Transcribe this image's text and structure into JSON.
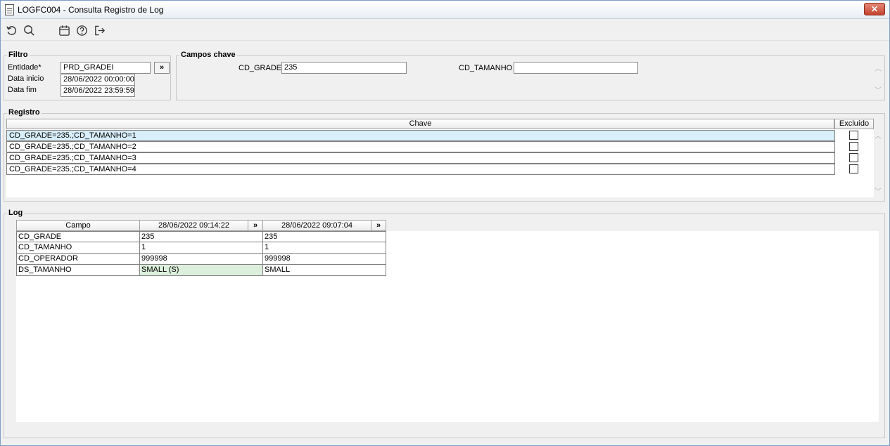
{
  "window": {
    "title": "LOGFC004 - Consulta Registro de Log",
    "close_label": "✕"
  },
  "toolbar": {
    "buttons": [
      {
        "name": "refresh-icon"
      },
      {
        "name": "search-icon"
      },
      {
        "name": "calendar-icon"
      },
      {
        "name": "help-icon"
      },
      {
        "name": "exit-icon"
      }
    ]
  },
  "filtro": {
    "legend": "Filtro",
    "entidade_label": "Entidade*",
    "entidade_value": "PRD_GRADEI",
    "entidade_button": "»",
    "data_inicio_label": "Data inicio",
    "data_inicio_value": "28/06/2022 00:00:00",
    "data_fim_label": "Data fim",
    "data_fim_value": "28/06/2022 23:59:59"
  },
  "campos_chave": {
    "legend": "Campos chave",
    "fields": [
      {
        "label": "CD_GRADE",
        "value": "235"
      },
      {
        "label": "CD_TAMANHO",
        "value": ""
      }
    ]
  },
  "registro": {
    "legend": "Registro",
    "col_chave": "Chave",
    "col_excluido": "Excluído",
    "rows": [
      {
        "chave": "CD_GRADE=235.;CD_TAMANHO=1",
        "excluido": false
      },
      {
        "chave": "CD_GRADE=235.;CD_TAMANHO=2",
        "excluido": false
      },
      {
        "chave": "CD_GRADE=235.;CD_TAMANHO=3",
        "excluido": false
      },
      {
        "chave": "CD_GRADE=235.;CD_TAMANHO=4",
        "excluido": false
      }
    ]
  },
  "log": {
    "legend": "Log",
    "col_campo": "Campo",
    "columns": [
      {
        "timestamp": "28/06/2022 09:14:22",
        "button": "»"
      },
      {
        "timestamp": "28/06/2022 09:07:04",
        "button": "»"
      }
    ],
    "rows": [
      {
        "campo": "CD_GRADE",
        "values": [
          "235",
          "235"
        ]
      },
      {
        "campo": "CD_TAMANHO",
        "values": [
          "1",
          "1"
        ]
      },
      {
        "campo": "CD_OPERADOR",
        "values": [
          "999998",
          "999998"
        ]
      },
      {
        "campo": "DS_TAMANHO",
        "values": [
          "SMALL (S)",
          "SMALL"
        ]
      }
    ],
    "highlight_color": "#dcefdc"
  }
}
